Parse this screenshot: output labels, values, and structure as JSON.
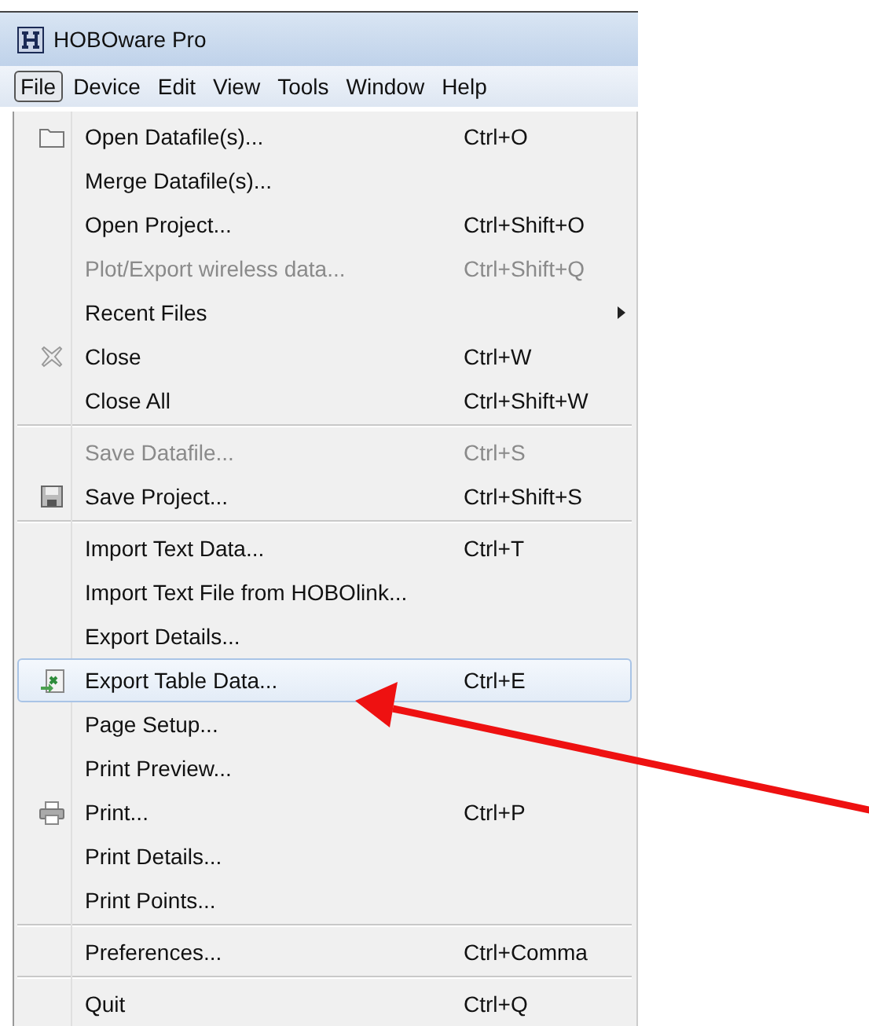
{
  "window": {
    "title": "HOBOware Pro"
  },
  "menubar": [
    {
      "label": "File",
      "selected": true
    },
    {
      "label": "Device",
      "selected": false
    },
    {
      "label": "Edit",
      "selected": false
    },
    {
      "label": "View",
      "selected": false
    },
    {
      "label": "Tools",
      "selected": false
    },
    {
      "label": "Window",
      "selected": false
    },
    {
      "label": "Help",
      "selected": false
    }
  ],
  "file_menu": [
    {
      "kind": "folder",
      "label": "Open Datafile(s)...",
      "shortcut": "Ctrl+O",
      "disabled": false,
      "selected": false
    },
    {
      "kind": "item",
      "label": "Merge Datafile(s)...",
      "disabled": false,
      "selected": false
    },
    {
      "kind": "item",
      "label": "Open Project...",
      "shortcut": "Ctrl+Shift+O",
      "disabled": false,
      "selected": false
    },
    {
      "kind": "item",
      "label": "Plot/Export wireless data...",
      "shortcut": "Ctrl+Shift+Q",
      "disabled": true,
      "selected": false
    },
    {
      "kind": "item",
      "label": "Recent Files",
      "submenu": true,
      "disabled": false,
      "selected": false
    },
    {
      "kind": "close",
      "label": "Close",
      "shortcut": "Ctrl+W",
      "disabled": false,
      "selected": false
    },
    {
      "kind": "item",
      "label": "Close All",
      "shortcut": "Ctrl+Shift+W",
      "disabled": false,
      "selected": false
    },
    {
      "kind": "separator"
    },
    {
      "kind": "item",
      "label": "Save Datafile...",
      "shortcut": "Ctrl+S",
      "disabled": true,
      "selected": false
    },
    {
      "kind": "save",
      "label": "Save Project...",
      "shortcut": "Ctrl+Shift+S",
      "disabled": false,
      "selected": false
    },
    {
      "kind": "separator"
    },
    {
      "kind": "item",
      "label": "Import Text Data...",
      "shortcut": "Ctrl+T",
      "disabled": false,
      "selected": false
    },
    {
      "kind": "item",
      "label": "Import Text File from HOBOlink...",
      "disabled": false,
      "selected": false
    },
    {
      "kind": "item",
      "label": "Export Details...",
      "disabled": false,
      "selected": false
    },
    {
      "kind": "export",
      "label": "Export Table Data...",
      "shortcut": "Ctrl+E",
      "disabled": false,
      "selected": true
    },
    {
      "kind": "item",
      "label": "Page Setup...",
      "disabled": false,
      "selected": false
    },
    {
      "kind": "item",
      "label": "Print Preview...",
      "disabled": false,
      "selected": false
    },
    {
      "kind": "print",
      "label": "Print...",
      "shortcut": "Ctrl+P",
      "disabled": false,
      "selected": false
    },
    {
      "kind": "item",
      "label": "Print Details...",
      "disabled": false,
      "selected": false
    },
    {
      "kind": "item",
      "label": "Print Points...",
      "disabled": false,
      "selected": false
    },
    {
      "kind": "separator"
    },
    {
      "kind": "item",
      "label": "Preferences...",
      "shortcut": "Ctrl+Comma",
      "disabled": false,
      "selected": false
    },
    {
      "kind": "separator"
    },
    {
      "kind": "item",
      "label": "Quit",
      "shortcut": "Ctrl+Q",
      "disabled": false,
      "selected": false
    }
  ]
}
